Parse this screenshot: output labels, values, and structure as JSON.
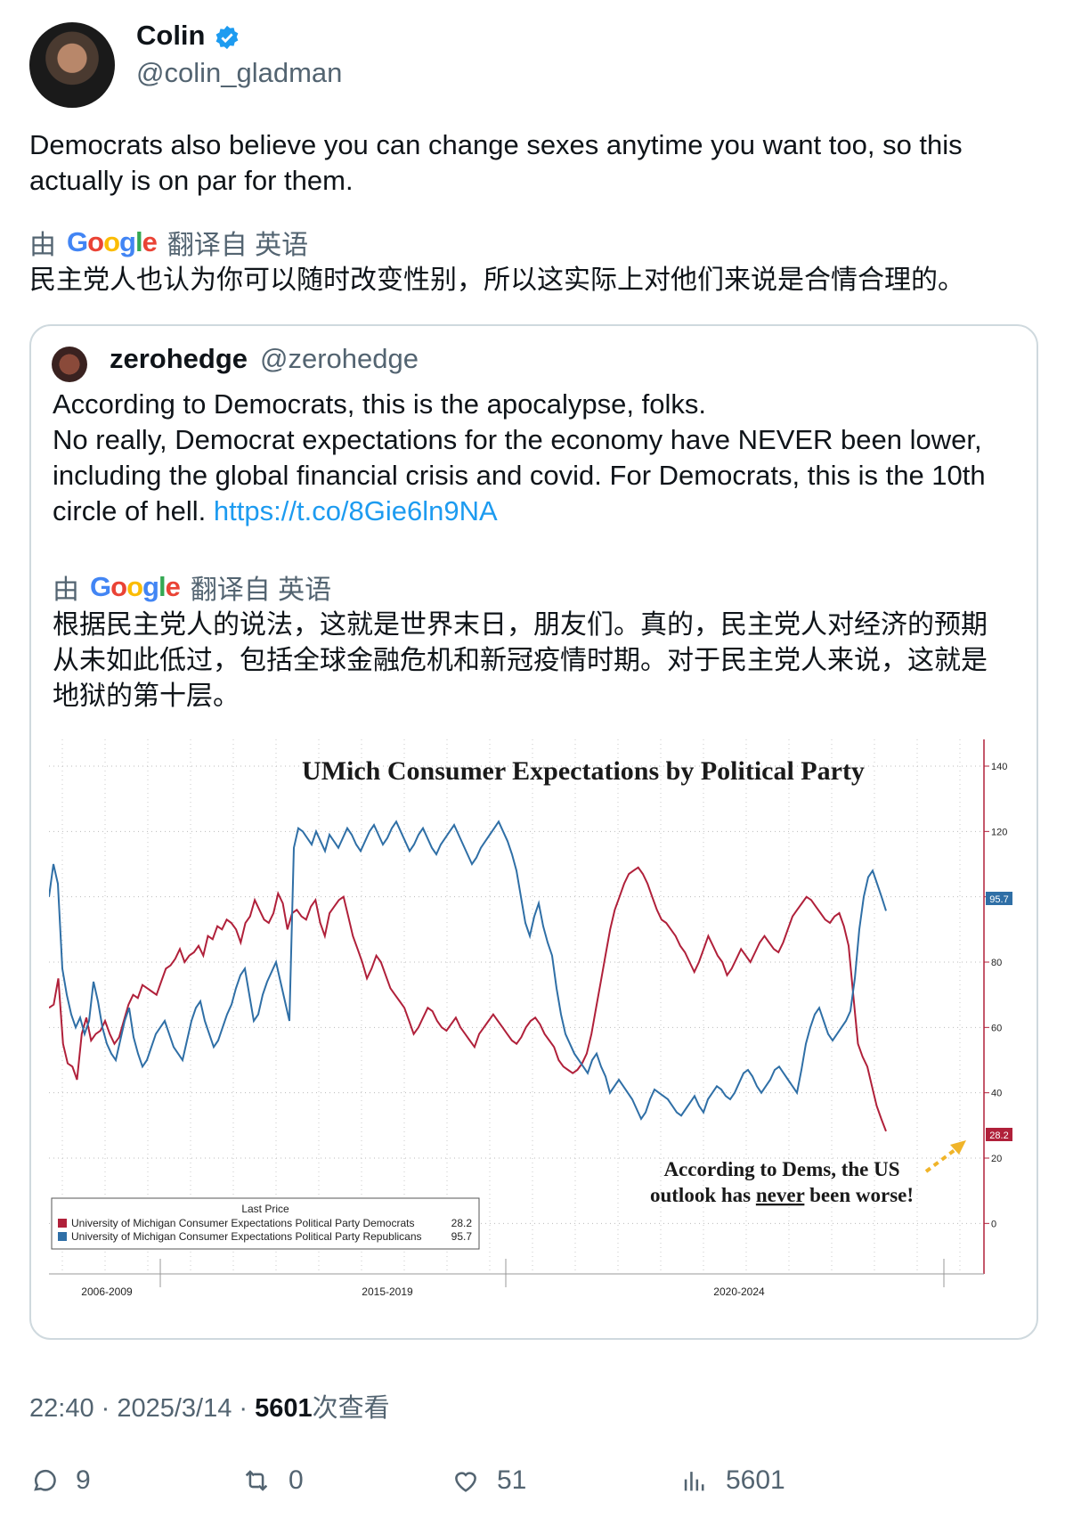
{
  "author": {
    "name": "Colin",
    "handle": "@colin_gladman"
  },
  "tweet": {
    "text": "Democrats also believe you can change sexes anytime you want too, so this actually is on par for them.",
    "translation_prefix": "由",
    "translation_brand": "Google",
    "translation_suffix": "翻译自 英语",
    "translation": "民主党人也认为你可以随时改变性别，所以这实际上对他们来说是合情合理的。"
  },
  "quote": {
    "name": "zerohedge",
    "handle": "@zerohedge",
    "line1": "According to Democrats, this is the apocalypse, folks.",
    "line2": "No really, Democrat expectations for the economy have NEVER been lower, including the global financial crisis and covid. For Democrats, this is the 10th circle of hell.",
    "link": "https://t.co/8Gie6ln9NA",
    "translation_prefix": "由",
    "translation_brand": "Google",
    "translation_suffix": "翻译自 英语",
    "translation": "根据民主党人的说法，这就是世界末日，朋友们。真的，民主党人对经济的预期从未如此低过，包括全球金融危机和新冠疫情时期。对于民主党人来说，这就是地狱的第十层。"
  },
  "chart_data": {
    "type": "line",
    "title": "UMich Consumer Expectations by Political Party",
    "annotation_line1": "According to Dems, the US",
    "annotation_line2_a": "outlook has ",
    "annotation_line2_b": "never",
    "annotation_line2_c": " been worse!",
    "ylim": [
      -10,
      140
    ],
    "y_ticks": [
      "0",
      "20",
      "40",
      "60",
      "80",
      "100",
      "120",
      "140"
    ],
    "period_labels": [
      "2006-2009",
      "2015-2019",
      "2020-2024"
    ],
    "legend_header": "Last Price",
    "series": [
      {
        "name": "University of Michigan Consumer Expectations Political Party Democrats",
        "last": "28.2",
        "color": "#b0203a",
        "values": [
          66,
          67,
          75,
          55,
          49,
          48,
          44,
          58,
          63,
          56,
          58,
          59,
          62,
          58,
          55,
          57,
          62,
          67,
          70,
          69,
          73,
          72,
          71,
          70,
          74,
          78,
          79,
          81,
          84,
          80,
          82,
          83,
          85,
          82,
          88,
          87,
          91,
          90,
          93,
          92,
          90,
          86,
          92,
          94,
          99,
          96,
          93,
          92,
          95,
          101,
          98,
          90,
          95,
          96,
          94,
          93,
          97,
          99,
          92,
          88,
          95,
          97,
          99,
          100,
          94,
          88,
          84,
          80,
          75,
          78,
          82,
          80,
          76,
          72,
          70,
          68,
          66,
          62,
          58,
          60,
          63,
          66,
          65,
          62,
          60,
          59,
          61,
          63,
          60,
          58,
          56,
          54,
          58,
          60,
          62,
          64,
          62,
          60,
          58,
          56,
          55,
          57,
          60,
          62,
          63,
          61,
          58,
          56,
          54,
          50,
          48,
          47,
          46,
          47,
          49,
          52,
          58,
          66,
          74,
          82,
          90,
          96,
          100,
          104,
          107,
          108,
          109,
          107,
          104,
          100,
          96,
          93,
          92,
          90,
          88,
          85,
          83,
          80,
          77,
          80,
          84,
          88,
          85,
          82,
          80,
          76,
          78,
          81,
          84,
          82,
          80,
          83,
          86,
          88,
          86,
          84,
          83,
          86,
          90,
          94,
          96,
          98,
          100,
          99,
          97,
          95,
          93,
          92,
          94,
          95,
          91,
          85,
          70,
          55,
          51,
          48,
          42,
          36,
          32,
          28.2
        ]
      },
      {
        "name": "University of Michigan Consumer Expectations Political Party Republicans",
        "last": "95.7",
        "color": "#2f6fa6",
        "values": [
          100,
          110,
          104,
          78,
          70,
          64,
          60,
          63,
          58,
          62,
          74,
          68,
          60,
          55,
          52,
          50,
          56,
          62,
          66,
          57,
          52,
          48,
          50,
          54,
          58,
          60,
          62,
          58,
          54,
          52,
          50,
          56,
          62,
          66,
          68,
          62,
          58,
          54,
          56,
          60,
          64,
          67,
          72,
          76,
          78,
          70,
          62,
          64,
          70,
          74,
          77,
          80,
          74,
          68,
          62,
          115,
          121,
          120,
          118,
          116,
          120,
          117,
          114,
          119,
          117,
          115,
          118,
          121,
          119,
          116,
          114,
          117,
          120,
          122,
          119,
          116,
          118,
          121,
          123,
          120,
          117,
          114,
          116,
          119,
          121,
          118,
          115,
          113,
          116,
          118,
          120,
          122,
          119,
          116,
          113,
          110,
          112,
          115,
          117,
          119,
          121,
          123,
          120,
          117,
          113,
          108,
          100,
          92,
          88,
          94,
          98,
          91,
          86,
          82,
          72,
          64,
          58,
          55,
          52,
          50,
          48,
          46,
          50,
          52,
          48,
          45,
          40,
          42,
          44,
          42,
          40,
          38,
          35,
          32,
          34,
          38,
          41,
          40,
          39,
          38,
          36,
          34,
          33,
          35,
          37,
          39,
          36,
          34,
          38,
          40,
          42,
          41,
          39,
          38,
          40,
          43,
          46,
          47,
          45,
          42,
          40,
          42,
          44,
          47,
          48,
          46,
          44,
          42,
          40,
          47,
          55,
          60,
          64,
          66,
          62,
          58,
          56,
          58,
          60,
          62,
          65,
          75,
          90,
          100,
          106,
          108,
          104,
          100,
          95.7
        ]
      }
    ]
  },
  "meta": {
    "time": "22:40",
    "sep": " · ",
    "date": "2025/3/14",
    "views": "5601",
    "views_label": "次查看"
  },
  "actions": {
    "replies": "9",
    "retweets": "0",
    "likes": "51",
    "views": "5601"
  }
}
